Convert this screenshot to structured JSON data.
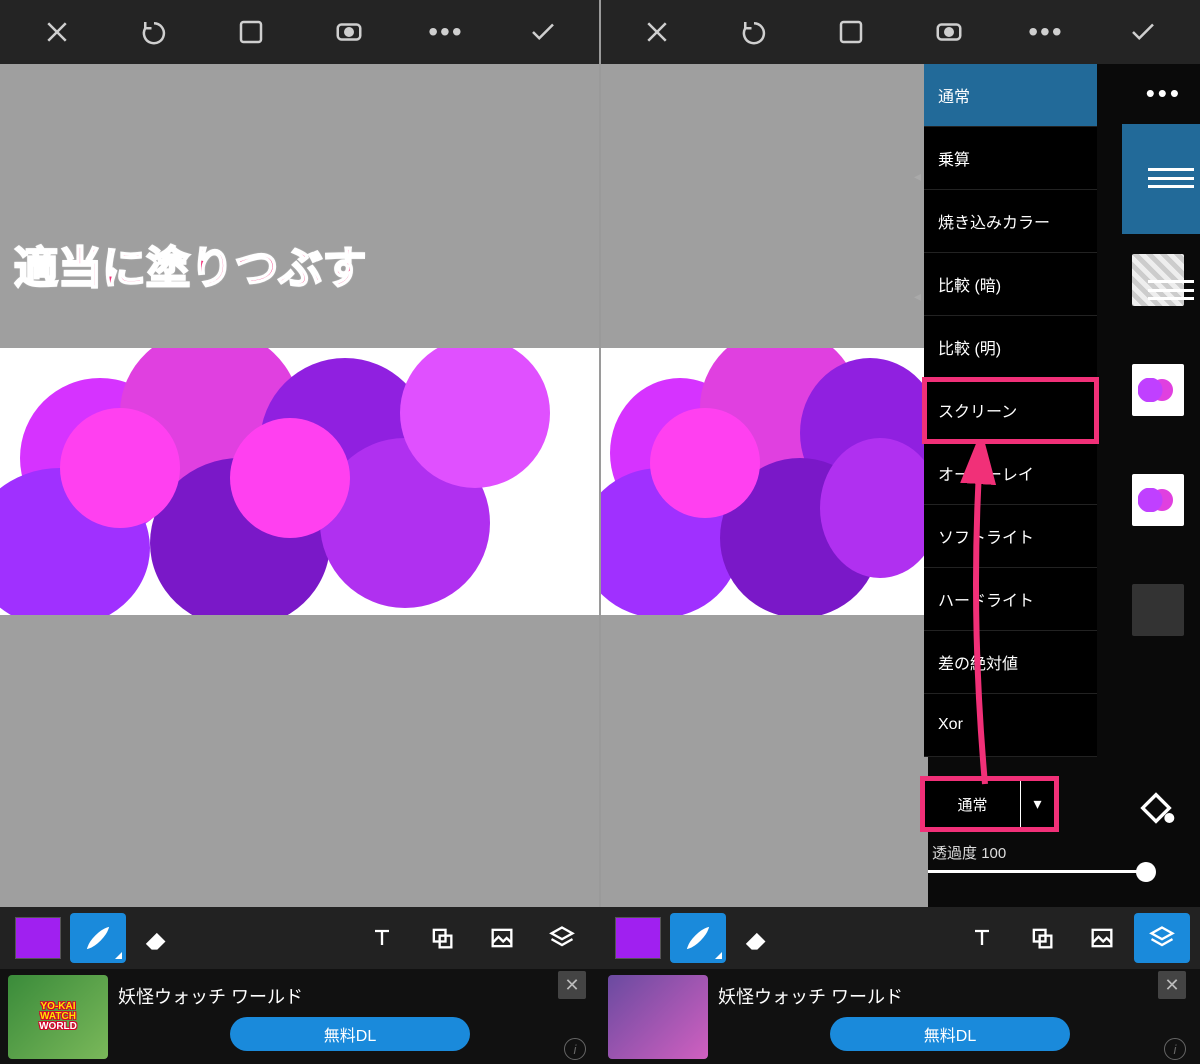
{
  "annotation": {
    "text": "適当に塗りつぶす"
  },
  "blend_modes": {
    "items": [
      {
        "label": "通常",
        "selected": true
      },
      {
        "label": "乗算"
      },
      {
        "label": "焼き込みカラー"
      },
      {
        "label": "比較 (暗)"
      },
      {
        "label": "比較 (明)"
      },
      {
        "label": "スクリーン",
        "highlighted": true
      },
      {
        "label": "オーバーレイ"
      },
      {
        "label": "ソフトライト"
      },
      {
        "label": "ハードライト"
      },
      {
        "label": "差の絶対値"
      },
      {
        "label": "Xor"
      }
    ],
    "current_button": "通常"
  },
  "opacity": {
    "label": "透過度",
    "value": "100"
  },
  "toolbar": {
    "color_hex": "#a020f0"
  },
  "ad": {
    "title": "妖怪ウォッチ ワールド",
    "button": "無料DL",
    "logo_line1": "YO-KAI",
    "logo_line2": "WATCH",
    "logo_line3": "WORLD"
  }
}
